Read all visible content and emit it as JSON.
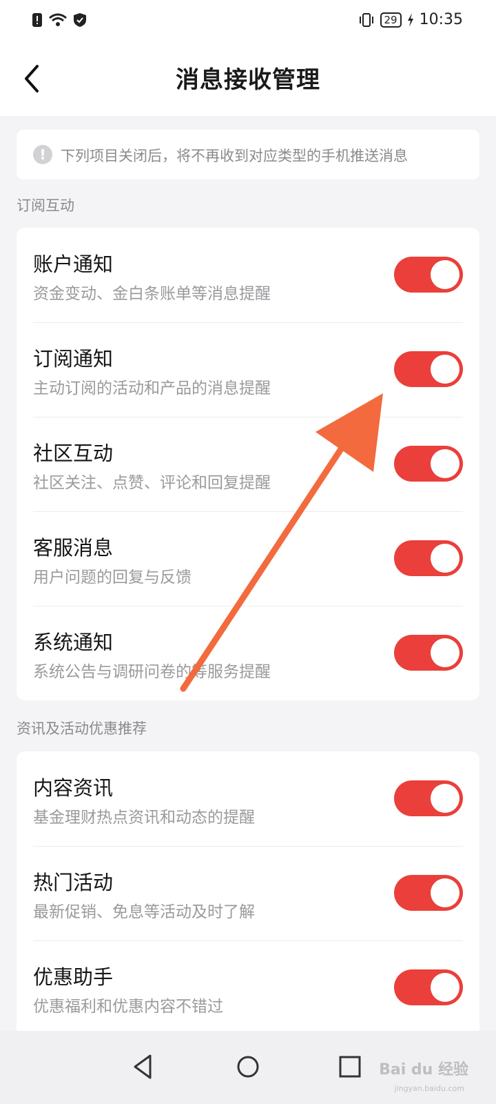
{
  "status": {
    "time": "10:35",
    "battery": "29"
  },
  "header": {
    "title": "消息接收管理"
  },
  "notice": {
    "text": "下列项目关闭后，将不再收到对应类型的手机推送消息"
  },
  "sections": [
    {
      "label": "订阅互动",
      "items": [
        {
          "title": "账户通知",
          "subtitle": "资金变动、金白条账单等消息提醒",
          "enabled": true
        },
        {
          "title": "订阅通知",
          "subtitle": "主动订阅的活动和产品的消息提醒",
          "enabled": true
        },
        {
          "title": "社区互动",
          "subtitle": "社区关注、点赞、评论和回复提醒",
          "enabled": true
        },
        {
          "title": "客服消息",
          "subtitle": "用户问题的回复与反馈",
          "enabled": true
        },
        {
          "title": "系统通知",
          "subtitle": "系统公告与调研问卷的等服务提醒",
          "enabled": true
        }
      ]
    },
    {
      "label": "资讯及活动优惠推荐",
      "items": [
        {
          "title": "内容资讯",
          "subtitle": "基金理财热点资讯和动态的提醒",
          "enabled": true
        },
        {
          "title": "热门活动",
          "subtitle": "最新促销、免息等活动及时了解",
          "enabled": true
        },
        {
          "title": "优惠助手",
          "subtitle": "优惠福利和优惠内容不错过",
          "enabled": true
        }
      ]
    }
  ],
  "colors": {
    "toggle_on": "#ea3f3a",
    "annotation_arrow": "#f26a3d"
  },
  "watermark": {
    "text": "Bai du 经验",
    "sub": "jingyan.baidu.com"
  }
}
